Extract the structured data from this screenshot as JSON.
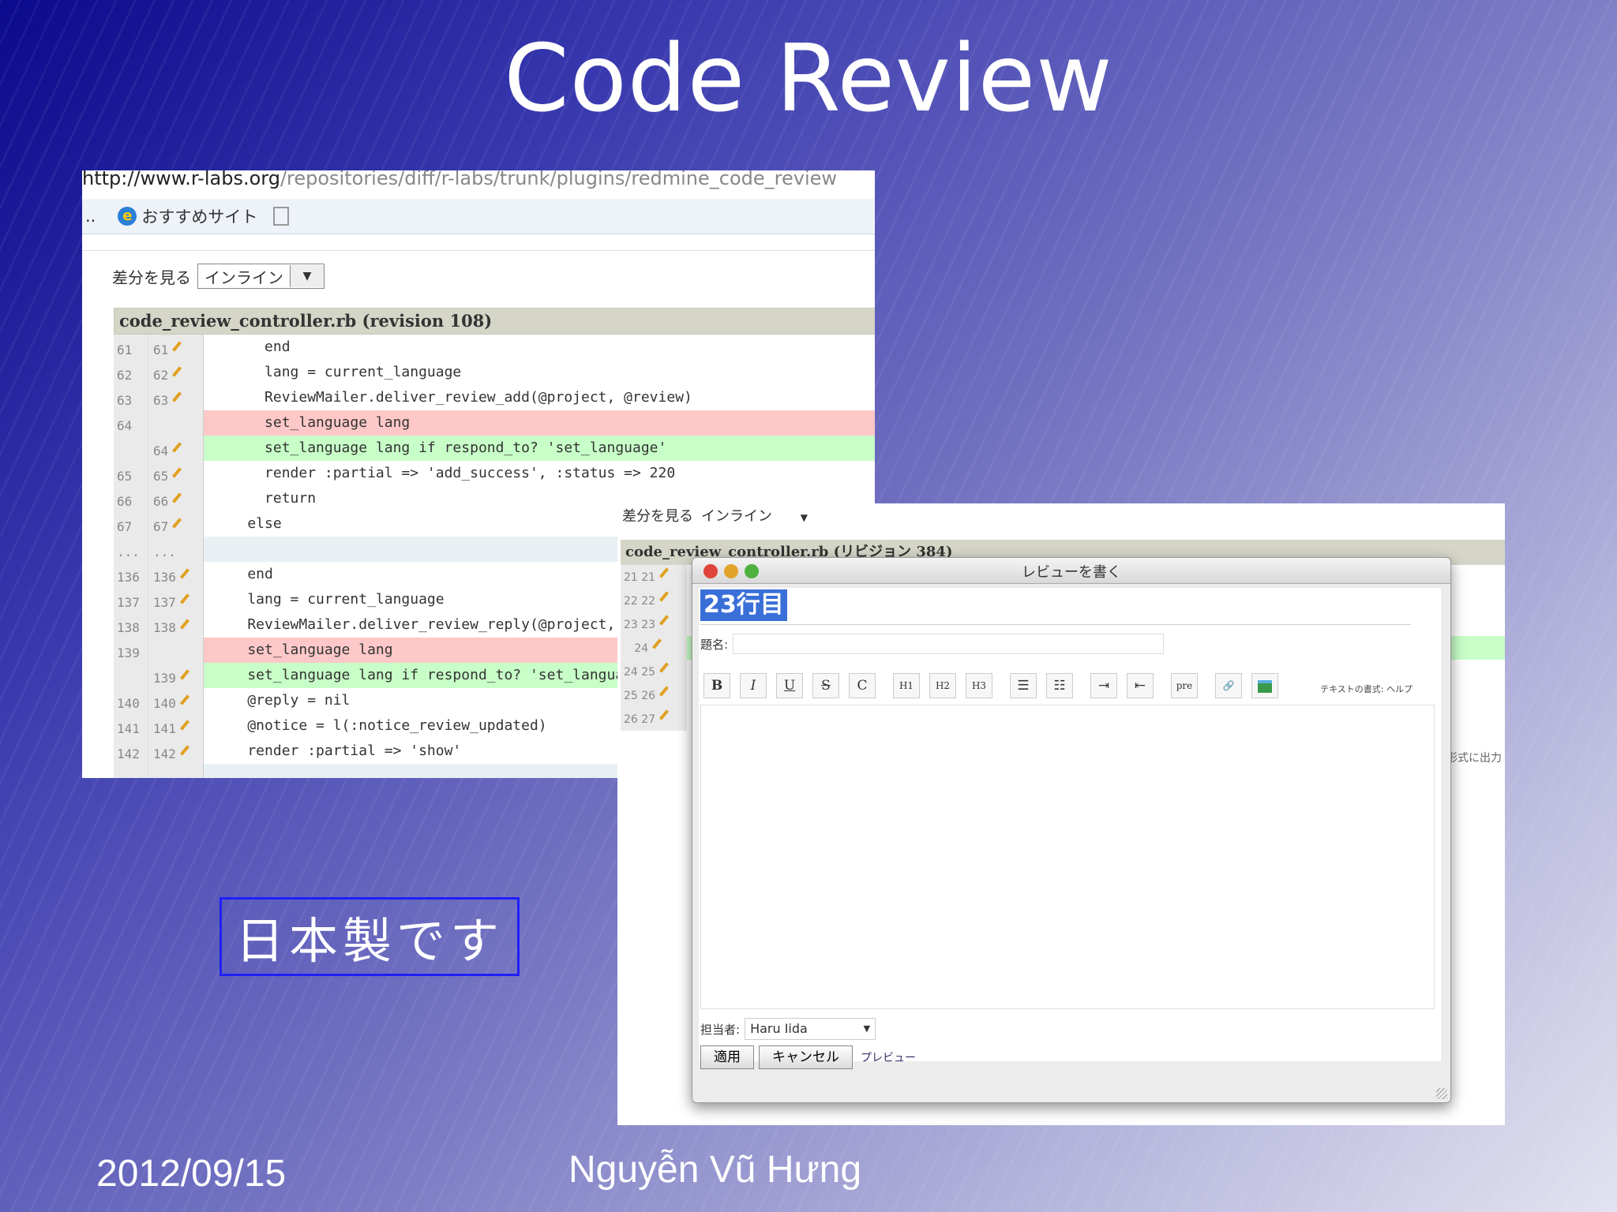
{
  "slide": {
    "title": "Code Review",
    "date": "2012/09/15",
    "author": "Nguyễn Vũ Hưng",
    "made_in_japan": "日本製です"
  },
  "screenshot1": {
    "url_host": "http://www.r-labs.org",
    "url_path": "/repositories/diff/r-labs/trunk/plugins/redmine_code_review",
    "favorites_label": "おすすめサイト",
    "diff_view_label": "差分を見る",
    "diff_view_value": "インライン",
    "file_header": "code_review_controller.rb (revision 108)",
    "rows": [
      {
        "o": "61",
        "n": "61",
        "code": "      end",
        "type": "ctx"
      },
      {
        "o": "62",
        "n": "62",
        "code": "      lang = current_language",
        "type": "ctx"
      },
      {
        "o": "63",
        "n": "63",
        "code": "      ReviewMailer.deliver_review_add(@project, @review)",
        "type": "ctx"
      },
      {
        "o": "64",
        "n": "",
        "code": "      set_language lang",
        "type": "del"
      },
      {
        "o": "",
        "n": "64",
        "code": "      set_language lang if respond_to? 'set_language'",
        "type": "add"
      },
      {
        "o": "65",
        "n": "65",
        "code": "      render :partial => 'add_success', :status => 220",
        "type": "ctx"
      },
      {
        "o": "66",
        "n": "66",
        "code": "      return",
        "type": "ctx"
      },
      {
        "o": "67",
        "n": "67",
        "code": "    else",
        "type": "ctx"
      },
      {
        "o": "...",
        "n": "...",
        "code": "",
        "type": "sep"
      },
      {
        "o": "136",
        "n": "136",
        "code": "    end",
        "type": "ctx"
      },
      {
        "o": "137",
        "n": "137",
        "code": "    lang = current_language",
        "type": "ctx"
      },
      {
        "o": "138",
        "n": "138",
        "code": "    ReviewMailer.deliver_review_reply(@project, @reply)",
        "type": "ctx"
      },
      {
        "o": "139",
        "n": "",
        "code": "    set_language lang",
        "type": "del"
      },
      {
        "o": "",
        "n": "139",
        "code": "    set_language lang if respond_to? 'set_language'",
        "type": "add"
      },
      {
        "o": "140",
        "n": "140",
        "code": "    @reply = nil",
        "type": "ctx"
      },
      {
        "o": "141",
        "n": "141",
        "code": "    @notice = l(:notice_review_updated)",
        "type": "ctx"
      },
      {
        "o": "142",
        "n": "142",
        "code": "    render :partial => 'show'",
        "type": "ctx"
      },
      {
        "o": "...",
        "n": "...",
        "code": "",
        "type": "sep"
      }
    ]
  },
  "screenshot2": {
    "diff_view_label": "差分を見る",
    "diff_view_value": "インライン",
    "file_header": "code_review_controller.rb (リビジョン 384)",
    "rows": [
      {
        "lines": "21 21",
        "type": "ctx"
      },
      {
        "lines": "22 22",
        "type": "ctx"
      },
      {
        "lines": "23 23",
        "type": "ctx"
      },
      {
        "lines": "   24",
        "type": "add"
      },
      {
        "lines": "24 25",
        "type": "ctx"
      },
      {
        "lines": "25 26",
        "type": "ctx"
      },
      {
        "lines": "26 27",
        "type": "ctx"
      }
    ],
    "side_note": "形式に出力",
    "dialog": {
      "title": "レビューを書く",
      "line_label": "23行目",
      "subject_label": "題名:",
      "toolbar": [
        "B",
        "I",
        "U",
        "S",
        "C",
        "H1",
        "H2",
        "H3",
        "ul",
        "ol",
        "indent",
        "outdent",
        "pre",
        "link",
        "image"
      ],
      "help_text": "テキストの書式: ヘルプ",
      "assignee_label": "担当者:",
      "assignee_value": "Haru Iida",
      "apply_button": "適用",
      "cancel_button": "キャンセル",
      "preview_link": "プレビュー"
    }
  }
}
